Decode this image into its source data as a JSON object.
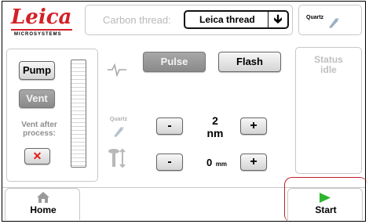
{
  "header": {
    "logo_text": "Leica",
    "logo_sub": "MICROSYSTEMS",
    "carbon_label": "Carbon thread:",
    "carbon_value": "Leica thread",
    "quartz_label": "Quartz"
  },
  "left_panel": {
    "pump_label": "Pump",
    "vent_label": "Vent",
    "vent_after_label": "Vent after process:"
  },
  "mode": {
    "pulse_label": "Pulse",
    "flash_label": "Flash"
  },
  "status": {
    "title": "Status",
    "value": "idle"
  },
  "thickness": {
    "icon_label": "Quartz",
    "minus": "-",
    "plus": "+",
    "value": "2",
    "unit": "nm"
  },
  "distance": {
    "minus": "-",
    "plus": "+",
    "value": "0",
    "unit": "mm"
  },
  "bottom": {
    "home_label": "Home",
    "start_label": "Start"
  },
  "colors": {
    "brand_red": "#d42027",
    "start_green": "#2fb52f",
    "cancel_red": "#e21a1a",
    "disabled_grey": "#9a9a9a"
  }
}
